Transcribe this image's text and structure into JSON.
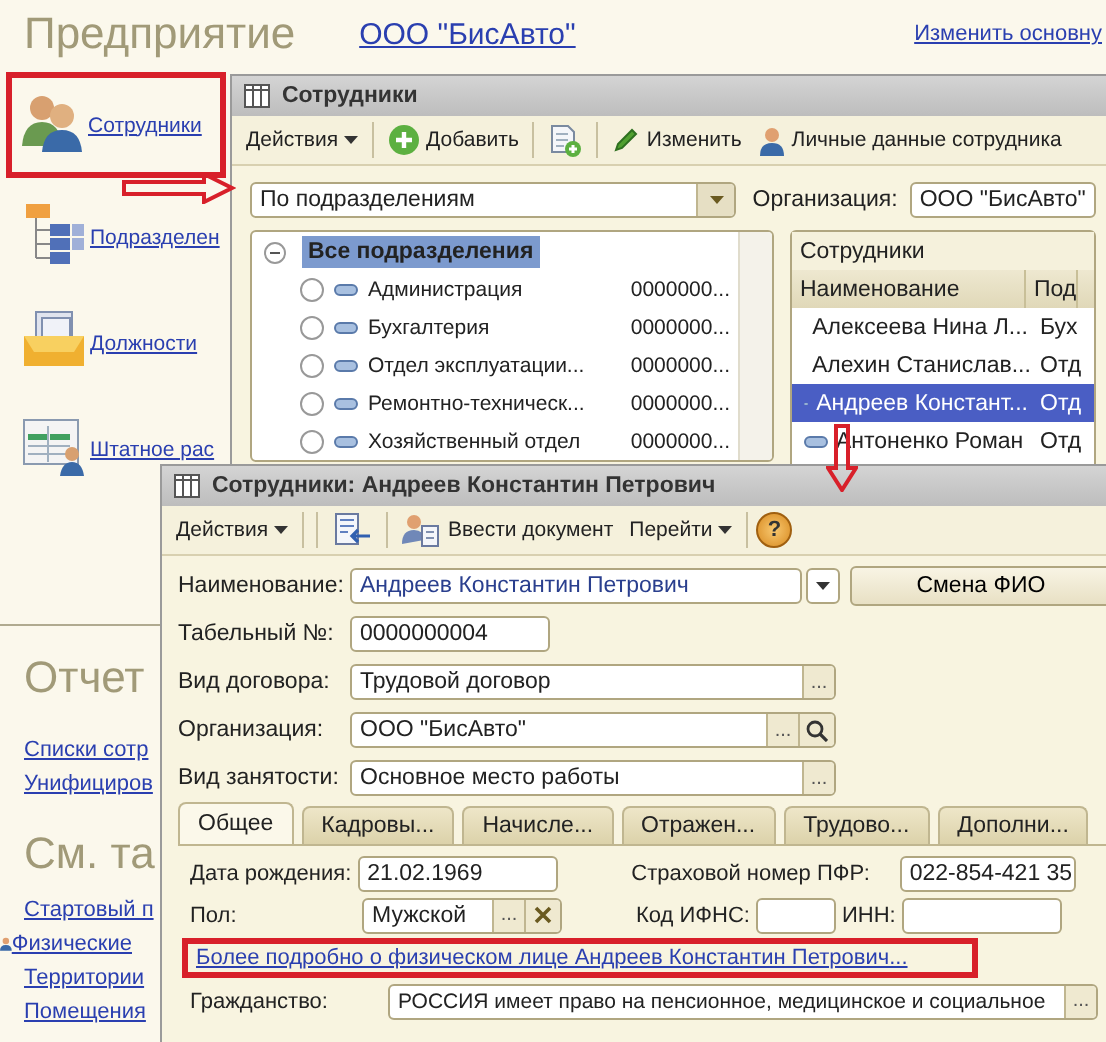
{
  "app_title": "Предприятие",
  "organization_link": "ООО \"БисАвто\"",
  "change_link": "Изменить основну",
  "sidebar": {
    "items": [
      {
        "label": "Сотрудники",
        "kind": "people",
        "highlighted": true
      },
      {
        "label": "Подразделен",
        "kind": "tree",
        "highlighted": false
      },
      {
        "label": "Должности",
        "kind": "folder",
        "highlighted": false
      },
      {
        "label": "Штатное рас",
        "kind": "table",
        "highlighted": false
      }
    ]
  },
  "reports": {
    "title": "Отчет",
    "links": [
      {
        "label": "Списки сотр"
      },
      {
        "label": "Унифициров"
      }
    ]
  },
  "see_also": {
    "title": "См. та",
    "links": [
      {
        "label": "Стартовый п",
        "kind": "plain"
      },
      {
        "label": "Физические",
        "kind": "person"
      },
      {
        "label": "Территории",
        "kind": "plain"
      },
      {
        "label": "Помещения",
        "kind": "plain"
      }
    ]
  },
  "list_window": {
    "title": "Сотрудники",
    "toolbar": [
      {
        "label": "Действия",
        "kind": "menu"
      },
      {
        "label": "Добавить",
        "kind": "add"
      },
      {
        "kind": "copy"
      },
      {
        "label": "Изменить",
        "kind": "edit"
      },
      {
        "label": "Личные данные сотрудника",
        "kind": "person"
      }
    ],
    "view_select": "По подразделениям",
    "org_label": "Организация:",
    "org_value": "ООО \"БисАвто\"",
    "tree": [
      {
        "label": "Все подразделения",
        "expanded": true,
        "selected": true,
        "children": [
          {
            "label": "Администрация",
            "code": "0000000...",
            "selected": false
          },
          {
            "label": "Бухгалтерия",
            "code": "0000000...",
            "selected": false
          },
          {
            "label": "Отдел эксплуатации...",
            "code": "0000000...",
            "selected": false
          },
          {
            "label": "Ремонтно-техническ...",
            "code": "0000000...",
            "selected": false
          },
          {
            "label": "Хозяйственный отдел",
            "code": "0000000...",
            "selected": false
          }
        ]
      }
    ],
    "list": {
      "title": "Сотрудники",
      "columns": [
        "Наименование",
        "Под"
      ],
      "rows": [
        {
          "name": "Алексеева Нина Л...",
          "column_2": "Бух",
          "selected": false
        },
        {
          "name": "Алехин Станислав...",
          "column_2": "Отд",
          "selected": false
        },
        {
          "name": "Андреев Констант...",
          "column_2": "Отд",
          "selected": true
        },
        {
          "name": "Антоненко Роман",
          "column_2": "Отд",
          "selected": false
        }
      ]
    }
  },
  "form_window": {
    "title": "Сотрудники: Андреев Константин Петрович",
    "toolbar": [
      {
        "label": "Действия",
        "kind": "menu"
      },
      {
        "kind": "post"
      },
      {
        "label": "Ввести документ",
        "kind": "document"
      },
      {
        "label": "Перейти",
        "kind": "menu"
      },
      {
        "label": "?",
        "kind": "help"
      }
    ],
    "fields": [
      {
        "label": "Наименование:",
        "value": "Андреев Константин Петрович",
        "kind": "combo"
      },
      {
        "label": "Табельный №:",
        "value": "0000000004",
        "kind": "short"
      },
      {
        "label": "Вид договора:",
        "value": "Трудовой договор",
        "kind": "select",
        "button": "..."
      },
      {
        "label": "Организация:",
        "value": "ООО \"БисАвто\"",
        "kind": "search",
        "button": "..."
      },
      {
        "label": "Вид занятости:",
        "value": "Основное место работы",
        "kind": "select",
        "button": "..."
      }
    ],
    "rename_button": "Смена ФИО",
    "tabs": [
      {
        "label": "Общее",
        "selected": true
      },
      {
        "label": "Кадровы...",
        "selected": false
      },
      {
        "label": "Начисле...",
        "selected": false
      },
      {
        "label": "Отражен...",
        "selected": false
      },
      {
        "label": "Трудово...",
        "selected": false
      },
      {
        "label": "Дополни...",
        "selected": false
      }
    ],
    "birth_date": {
      "label": "Дата рождения:",
      "value": "21.02.1969"
    },
    "pension_number": {
      "label": "Страховой номер ПФР:",
      "value": "022-854-421 35"
    },
    "gender": {
      "label": "Пол:",
      "value": "Мужской",
      "button": "..."
    },
    "tax_office": {
      "label": "Код ИФНС:"
    },
    "inn": {
      "label": "ИНН:"
    },
    "details_link": "Более подробно о физическом лице Андреев Константин Петрович...",
    "citizenship": {
      "label": "Гражданство:",
      "value": "РОССИЯ имеет право на пенсионное, медицинское и социальное",
      "button": "..."
    }
  }
}
